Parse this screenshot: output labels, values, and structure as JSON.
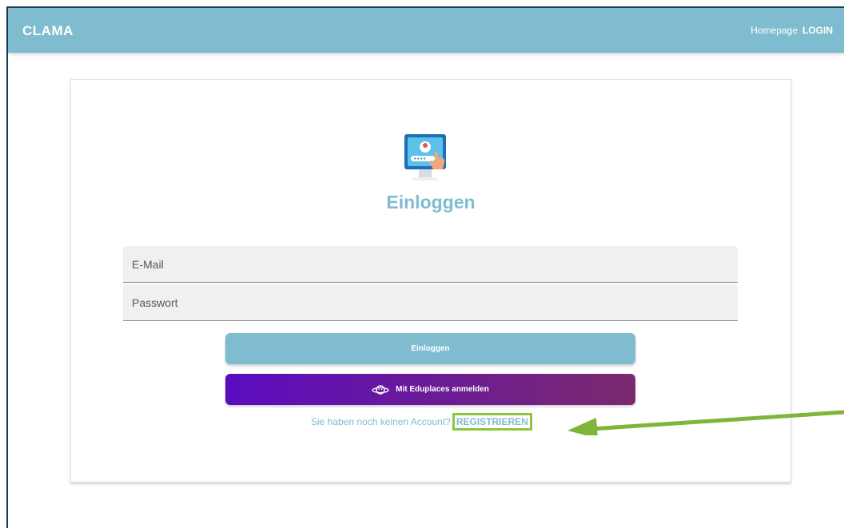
{
  "appbar": {
    "brand": "CLAMA",
    "nav": {
      "homepage": "Homepage",
      "login": "LOGIN"
    }
  },
  "login_card": {
    "title": "Einloggen",
    "email": {
      "placeholder": "E-Mail"
    },
    "password": {
      "placeholder": "Passwort"
    },
    "login_button": "Einloggen",
    "eduplaces_button": "Mit Eduplaces anmelden",
    "register_prompt": "Sie haben noch keinen Account?",
    "register_link": "REGISTRIEREN"
  },
  "colors": {
    "accent": "#7fbcd0",
    "eduplaces_gradient_start": "#5b0cc0",
    "eduplaces_gradient_end": "#7a2a6e",
    "highlight": "#8cc63f"
  },
  "icons": {
    "logo": "computer-login-icon",
    "eduplaces": "planet-icon",
    "annotation": "arrow-left-icon"
  }
}
